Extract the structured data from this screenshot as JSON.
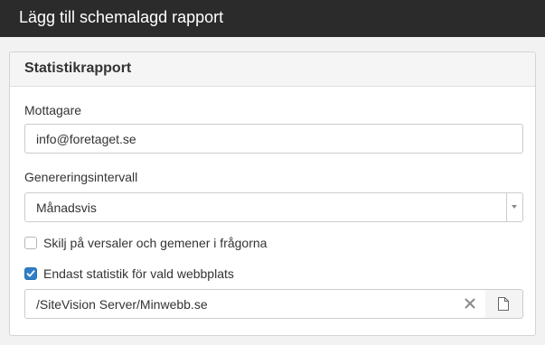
{
  "dialog": {
    "title": "Lägg till schemalagd rapport"
  },
  "panel": {
    "title": "Statistikrapport"
  },
  "recipient": {
    "label": "Mottagare",
    "value": "info@foretaget.se"
  },
  "interval": {
    "label": "Genereringsintervall",
    "selected": "Månadsvis"
  },
  "case_option": {
    "label": "Skilj på versaler och gemener i frågorna",
    "checked": false
  },
  "site_option": {
    "label": "Endast statistik för vald webbplats",
    "checked": true
  },
  "site_path": {
    "value": "/SiteVision Server/Minwebb.se"
  },
  "icons": {
    "clear": "close-icon",
    "browse": "file-icon",
    "select": "chevron-down-icon",
    "check": "checkmark-icon"
  },
  "colors": {
    "titlebar": "#2b2b2b",
    "checkbox_checked": "#2f7ec6"
  }
}
